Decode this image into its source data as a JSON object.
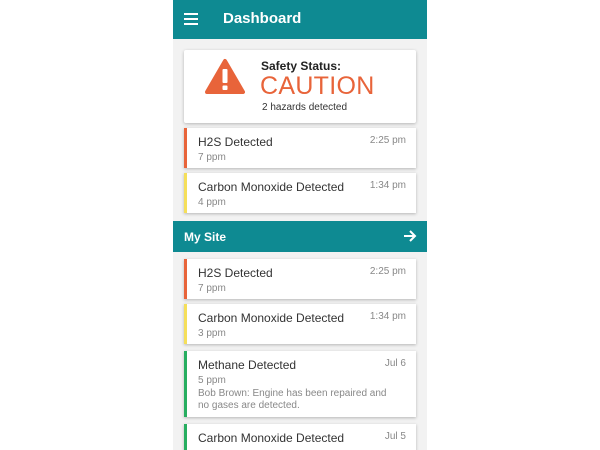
{
  "header": {
    "title": "Dashboard",
    "menu_icon": "hamburger-menu-icon"
  },
  "safety": {
    "label": "Safety Status:",
    "status": "CAUTION",
    "summary": "2 hazards detected",
    "icon": "warning-icon",
    "color": "#e8643a"
  },
  "recent_alerts": [
    {
      "title": "H2S Detected",
      "value": "7 ppm",
      "time": "2:25 pm",
      "severity_color": "#e8643a"
    },
    {
      "title": "Carbon Monoxide Detected",
      "value": "4 ppm",
      "time": "1:34 pm",
      "severity_color": "#f5df5a"
    }
  ],
  "site": {
    "title": "My Site",
    "arrow_icon": "arrow-right-icon",
    "alerts": [
      {
        "title": "H2S Detected",
        "value": "7 ppm",
        "time": "2:25 pm",
        "severity_color": "#e8643a"
      },
      {
        "title": "Carbon Monoxide Detected",
        "value": "3 ppm",
        "time": "1:34 pm",
        "severity_color": "#f5df5a"
      },
      {
        "title": "Methane Detected",
        "value": "5 ppm",
        "time": "Jul 6",
        "note": "Bob Brown: Engine has been repaired and no gases are detected.",
        "severity_color": "#27ae60"
      },
      {
        "title": "Carbon Monoxide Detected",
        "value": "",
        "time": "Jul 5",
        "severity_color": "#27ae60"
      }
    ]
  },
  "colors": {
    "primary": "#0e8a92",
    "caution": "#e8643a",
    "warning": "#f5df5a",
    "ok": "#27ae60"
  }
}
